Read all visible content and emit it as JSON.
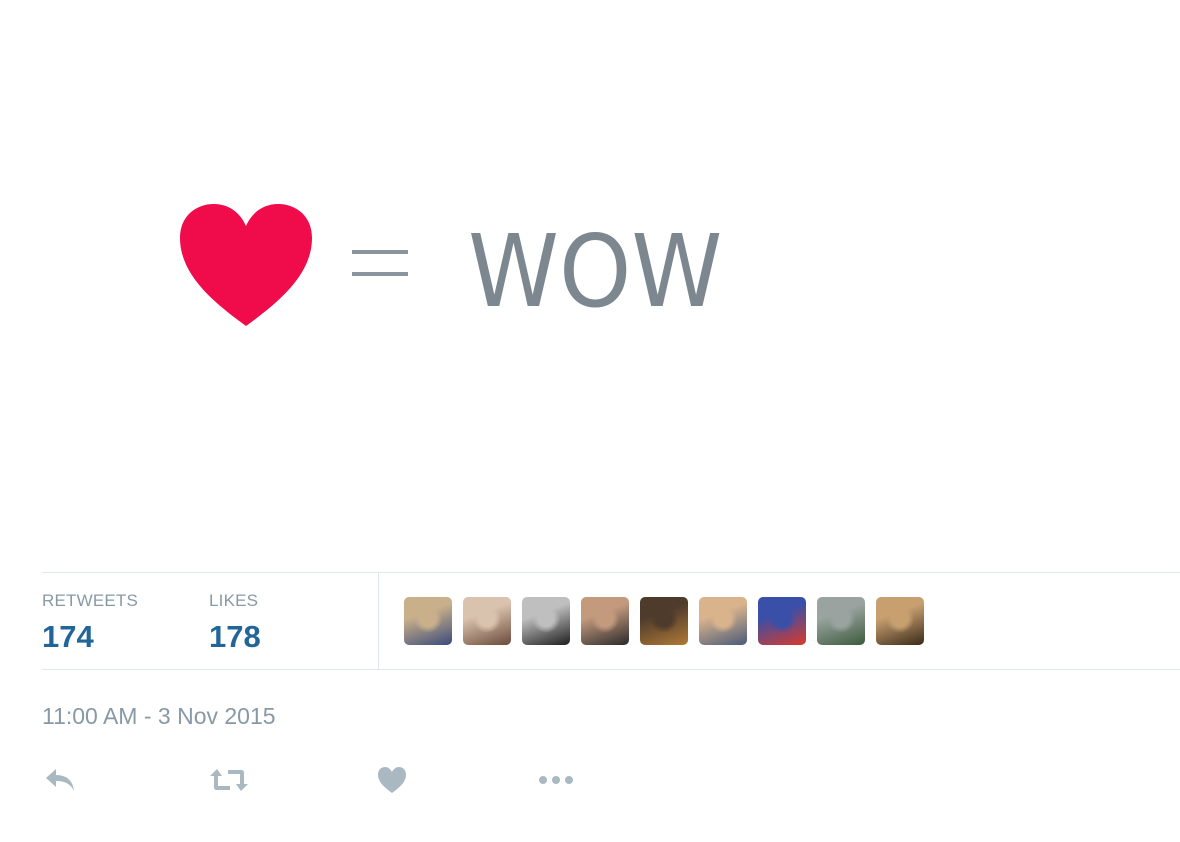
{
  "tweet": {
    "image": {
      "equals": "=",
      "text": "WOW",
      "heart_color": "#f00b4a",
      "text_color": "#7c878f"
    },
    "stats": {
      "retweets_label": "RETWEETS",
      "retweets_count": "174",
      "likes_label": "LIKES",
      "likes_count": "178"
    },
    "avatars": [
      {
        "name": "avatar-1",
        "colors": [
          "#3b4b7a",
          "#c9b08a"
        ]
      },
      {
        "name": "avatar-2",
        "colors": [
          "#6b4a3a",
          "#d9c2ae"
        ]
      },
      {
        "name": "avatar-3",
        "colors": [
          "#1e1e1e",
          "#bfbfbf"
        ]
      },
      {
        "name": "avatar-4",
        "colors": [
          "#2a2a2a",
          "#c49a7e"
        ]
      },
      {
        "name": "avatar-5",
        "colors": [
          "#b07a36",
          "#4f3b2c"
        ]
      },
      {
        "name": "avatar-6",
        "colors": [
          "#4a5a7a",
          "#d9b38c"
        ]
      },
      {
        "name": "avatar-7",
        "colors": [
          "#d93a2a",
          "#3a4fa8"
        ]
      },
      {
        "name": "avatar-8",
        "colors": [
          "#3c5b3c",
          "#9aa3a0"
        ]
      },
      {
        "name": "avatar-9",
        "colors": [
          "#3a2a1a",
          "#c8a070"
        ]
      }
    ],
    "timestamp": "11:00 AM - 3 Nov 2015",
    "actions": {
      "icon_color": "#aab8c2",
      "reply_icon": "reply-icon",
      "retweet_icon": "retweet-icon",
      "like_icon": "heart-icon",
      "more_icon": "more-icon"
    }
  }
}
